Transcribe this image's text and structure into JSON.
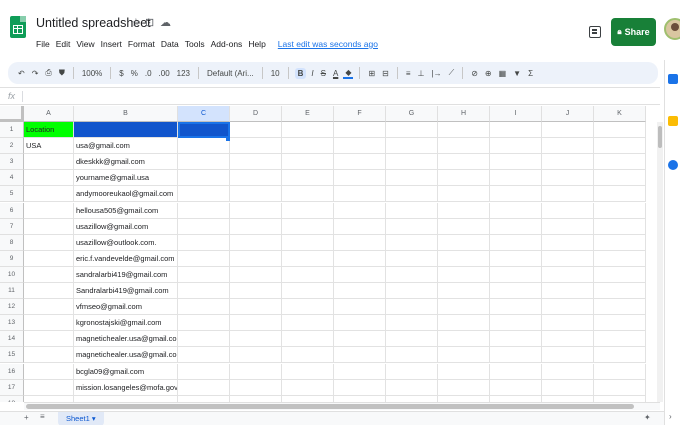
{
  "header": {
    "title": "Untitled spreadsheet",
    "star_icon": "☆",
    "move_icon": "⊡",
    "status_icon": "☁",
    "menu": [
      "File",
      "Edit",
      "View",
      "Insert",
      "Format",
      "Data",
      "Tools",
      "Add-ons",
      "Help"
    ],
    "last_edit": "Last edit was seconds ago",
    "share_label": "Share"
  },
  "toolbar": {
    "undo": "↶",
    "redo": "↷",
    "print": "⎙",
    "paint_format": "⛊",
    "zoom": "100%",
    "currency": "$",
    "percent": "%",
    "decrease_decimal": ".0",
    "increase_decimal": ".00",
    "more_formats": "123",
    "font": "Default (Ari...",
    "font_size": "10",
    "bold": "B",
    "italic": "I",
    "strikethrough": "S",
    "text_color": "A",
    "fill_color": "◆",
    "borders": "⊞",
    "merge": "⊟",
    "h_align": "≡",
    "v_align": "⊥",
    "wrap": "|→",
    "rotate": "⟋",
    "link": "⊘",
    "comment": "⊕",
    "chart": "▦",
    "filter": "▼",
    "functions": "Σ"
  },
  "formula_bar": {
    "label": "fx",
    "value": ""
  },
  "columns": [
    "A",
    "B",
    "C",
    "D",
    "E",
    "F",
    "G",
    "H",
    "I",
    "J",
    "K"
  ],
  "rows": [
    {
      "num": "1",
      "a": "Location",
      "b": ""
    },
    {
      "num": "2",
      "a": "USA",
      "b": "usa@gmail.com"
    },
    {
      "num": "3",
      "a": "",
      "b": "dkeskkk@gmail.com"
    },
    {
      "num": "4",
      "a": "",
      "b": "yourname@gmail.usa"
    },
    {
      "num": "5",
      "a": "",
      "b": "andymooreukaol@gmail.com"
    },
    {
      "num": "6",
      "a": "",
      "b": "hellousa505@gmail.com"
    },
    {
      "num": "7",
      "a": "",
      "b": "usazillow@gmail.com"
    },
    {
      "num": "8",
      "a": "",
      "b": "usazillow@outlook.com."
    },
    {
      "num": "9",
      "a": "",
      "b": "eric.f.vandevelde@gmail.com"
    },
    {
      "num": "10",
      "a": "",
      "b": "sandralarbi419@gmail.com"
    },
    {
      "num": "11",
      "a": "",
      "b": "Sandralarbi419@gmail.com"
    },
    {
      "num": "12",
      "a": "",
      "b": "vfmseo@gmail.com"
    },
    {
      "num": "13",
      "a": "",
      "b": "kgronostajski@gmail.com"
    },
    {
      "num": "14",
      "a": "",
      "b": "magnetichealer.usa@gmail.com..."
    },
    {
      "num": "15",
      "a": "",
      "b": "magnetichealer.usa@gmail.com"
    },
    {
      "num": "16",
      "a": "",
      "b": "bcgla09@gmail.com"
    },
    {
      "num": "17",
      "a": "",
      "b": "mission.losangeles@mofa.gov.bd"
    },
    {
      "num": "18",
      "a": "",
      "b": ""
    }
  ],
  "sheet_bar": {
    "add": "+",
    "all_sheets": "≡",
    "tab": "Sheet1 ▾",
    "explore": "✦"
  },
  "side_panel": {
    "expand": "›"
  },
  "colors": {
    "location_fill": "#00ff00",
    "header_blue": "#1155cc",
    "share_green": "#188038"
  }
}
